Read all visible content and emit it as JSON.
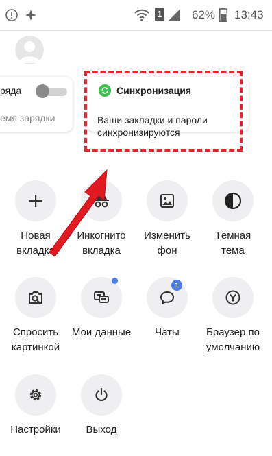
{
  "status_bar": {
    "battery_percent": "62%",
    "time": "13:43",
    "sim_number": "1"
  },
  "cards": {
    "charging": {
      "title": "ряда",
      "subtitle": "емя зарядки"
    },
    "sync": {
      "title": "Синхронизация",
      "text": "Ваши закладки и пароли синхронизируются"
    }
  },
  "menu": {
    "new_tab": "Новая вкладка",
    "incognito": "Инкогнито вкладка",
    "change_bg": "Изменить фон",
    "dark_theme": "Тёмная тема",
    "ask_picture": "Спросить картинкой",
    "my_data": "Мои данные",
    "chats": "Чаты",
    "default_browser": "Браузер по умолчанию",
    "settings": "Настройки",
    "exit": "Выход"
  },
  "chats_badge": "1",
  "colors": {
    "accent_blue": "#4a7cf0",
    "sync_green": "#3ac24a",
    "annotation_red": "#e4232a"
  }
}
